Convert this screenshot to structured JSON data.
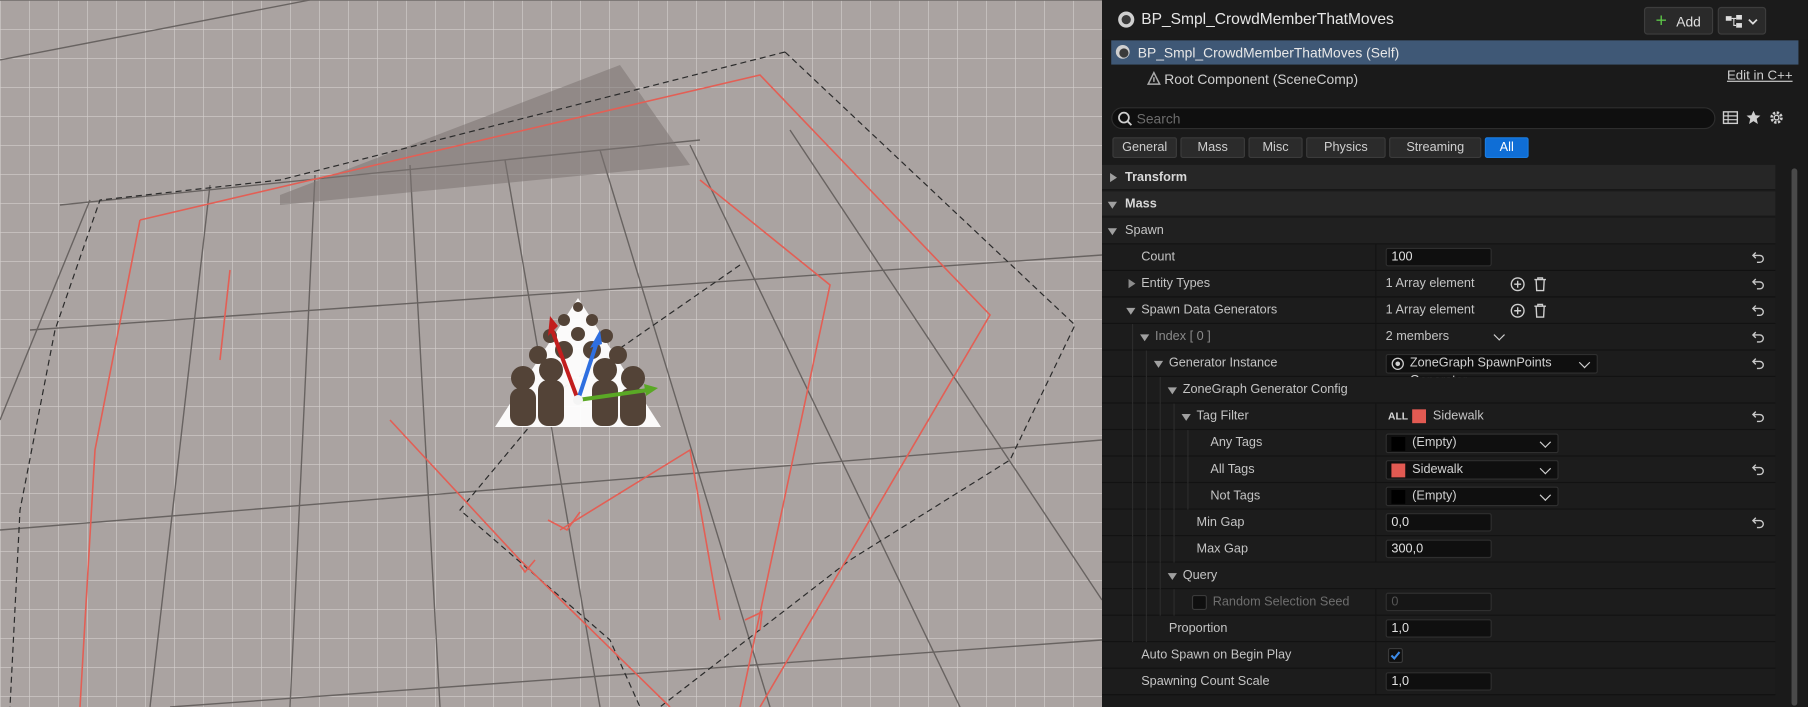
{
  "panel": {
    "title": "BP_Smpl_CrowdMemberThatMoves",
    "add_label": "Add",
    "components": {
      "self": "BP_Smpl_CrowdMemberThatMoves (Self)",
      "root": "Root Component (SceneComp)",
      "edit_cpp": "Edit in C++"
    },
    "search": {
      "placeholder": "Search"
    },
    "tabs": [
      "General",
      "Mass",
      "Misc",
      "Physics",
      "Streaming",
      "All"
    ],
    "active_tab": "All",
    "categories": {
      "transform": "Transform",
      "mass": "Mass",
      "spawn": "Spawn"
    },
    "properties": {
      "count": {
        "label": "Count",
        "value": "100"
      },
      "entity_types": {
        "label": "Entity Types",
        "value": "1 Array element"
      },
      "spawn_data_generators": {
        "label": "Spawn Data Generators",
        "value": "1 Array element"
      },
      "index": {
        "label": "Index [ 0 ]",
        "value": "2 members"
      },
      "generator_instance": {
        "label": "Generator Instance",
        "value": "ZoneGraph SpawnPoints Generator"
      },
      "zonegraph_config": {
        "label": "ZoneGraph Generator Config"
      },
      "tag_filter": {
        "label": "Tag Filter",
        "prefix": "ALL",
        "value": "Sidewalk"
      },
      "any_tags": {
        "label": "Any Tags",
        "value": "(Empty)"
      },
      "all_tags": {
        "label": "All Tags",
        "value": "Sidewalk"
      },
      "not_tags": {
        "label": "Not Tags",
        "value": "(Empty)"
      },
      "min_gap": {
        "label": "Min Gap",
        "value": "0,0"
      },
      "max_gap": {
        "label": "Max Gap",
        "value": "300,0"
      },
      "query": {
        "label": "Query"
      },
      "random_selection_seed": {
        "label": "Random Selection Seed",
        "value": "0"
      },
      "proportion": {
        "label": "Proportion",
        "value": "1,0"
      },
      "auto_spawn": {
        "label": "Auto Spawn on Begin Play",
        "checked": true
      },
      "spawning_count_scale": {
        "label": "Spawning Count Scale",
        "value": "1,0"
      }
    },
    "colors": {
      "sidewalk_tag": "#e25a52",
      "active_tab": "#0f6ed6",
      "selected_row": "#3f5876",
      "add_plus": "#5bc247"
    }
  }
}
